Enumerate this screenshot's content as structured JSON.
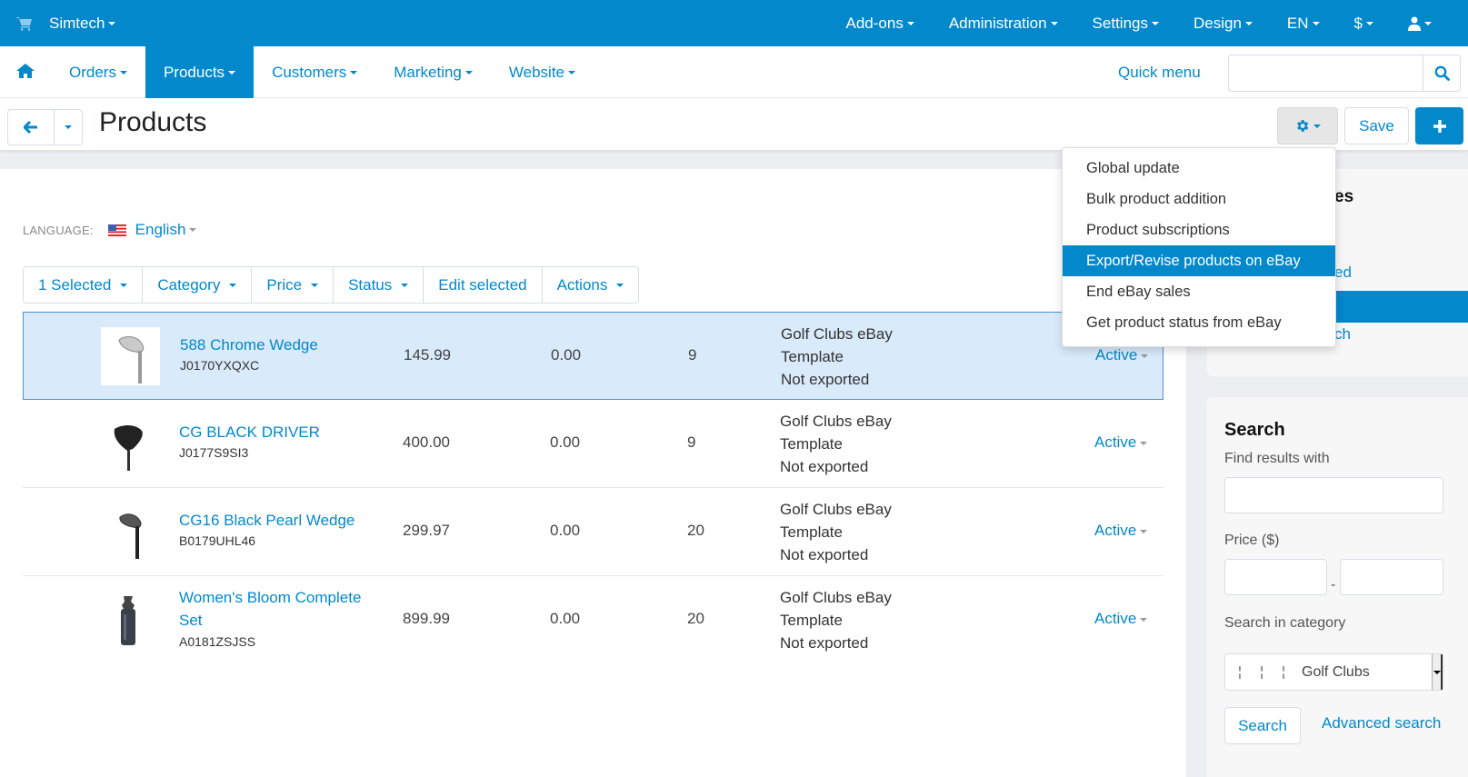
{
  "topbar": {
    "brand": "Simtech",
    "cart_icon": "shopping-cart-icon",
    "menu": [
      {
        "label": "Add-ons"
      },
      {
        "label": "Administration"
      },
      {
        "label": "Settings"
      },
      {
        "label": "Design"
      },
      {
        "label": "EN"
      },
      {
        "label": "$"
      }
    ],
    "user_icon": "user-icon"
  },
  "mainnav": {
    "home_icon": "home-icon",
    "tabs": [
      {
        "label": "Orders",
        "active": false
      },
      {
        "label": "Products",
        "active": true
      },
      {
        "label": "Customers",
        "active": false
      },
      {
        "label": "Marketing",
        "active": false
      },
      {
        "label": "Website",
        "active": false
      }
    ],
    "quick_menu": "Quick menu",
    "search_value": "",
    "search_placeholder": ""
  },
  "titlebar": {
    "title": "Products",
    "save": "Save"
  },
  "settings_dropdown": {
    "items": [
      {
        "label": "Global update",
        "highlighted": false
      },
      {
        "label": "Bulk product addition",
        "highlighted": false
      },
      {
        "label": "Product subscriptions",
        "highlighted": false
      },
      {
        "label": "Export/Revise products on eBay",
        "highlighted": true
      },
      {
        "label": "End eBay sales",
        "highlighted": false
      },
      {
        "label": "Get product status from eBay",
        "highlighted": false
      }
    ]
  },
  "language": {
    "label": "LANGUAGE:",
    "value": "English"
  },
  "toolbar": {
    "buttons": [
      {
        "label": "1 Selected",
        "dropdown": true
      },
      {
        "label": "Category",
        "dropdown": true
      },
      {
        "label": "Price",
        "dropdown": true
      },
      {
        "label": "Status",
        "dropdown": true
      },
      {
        "label": "Edit selected",
        "dropdown": false
      },
      {
        "label": "Actions",
        "dropdown": true
      }
    ]
  },
  "products": [
    {
      "name": "588 Chrome Wedge",
      "sku": "J0170YXQXC",
      "price": "145.99",
      "list_price": "0.00",
      "quantity": "9",
      "ebay_template": "Golf Clubs eBay Template",
      "ebay_status": "Not exported",
      "status": "Active",
      "selected": true,
      "thumb": "wedge-chrome"
    },
    {
      "name": "CG BLACK DRIVER",
      "sku": "J0177S9SI3",
      "price": "400.00",
      "list_price": "0.00",
      "quantity": "9",
      "ebay_template": "Golf Clubs eBay Template",
      "ebay_status": "Not exported",
      "status": "Active",
      "selected": false,
      "thumb": "driver-black"
    },
    {
      "name": "CG16 Black Pearl Wedge",
      "sku": "B0179UHL46",
      "price": "299.97",
      "list_price": "0.00",
      "quantity": "20",
      "ebay_template": "Golf Clubs eBay Template",
      "ebay_status": "Not exported",
      "status": "Active",
      "selected": false,
      "thumb": "wedge-black"
    },
    {
      "name": "Women's Bloom Complete Set",
      "sku": "A0181ZSJSS",
      "price": "899.99",
      "list_price": "0.00",
      "quantity": "20",
      "ebay_template": "Golf Clubs eBay Template",
      "ebay_status": "Not exported",
      "status": "Active",
      "selected": false,
      "thumb": "golf-bag"
    }
  ],
  "sidebar_views": {
    "heading_partial": "es",
    "link1_partial": "ed",
    "link2_partial": "ch"
  },
  "search_panel": {
    "title": "Search",
    "find_label": "Find results with",
    "find_value": "",
    "price_label": "Price ($)",
    "price_from": "",
    "price_to": "",
    "price_sep": "-",
    "category_label": "Search in category",
    "category_tree": "¦ ¦ ¦",
    "category_value": "Golf Clubs",
    "search_button": "Search",
    "advanced_link": "Advanced search"
  }
}
